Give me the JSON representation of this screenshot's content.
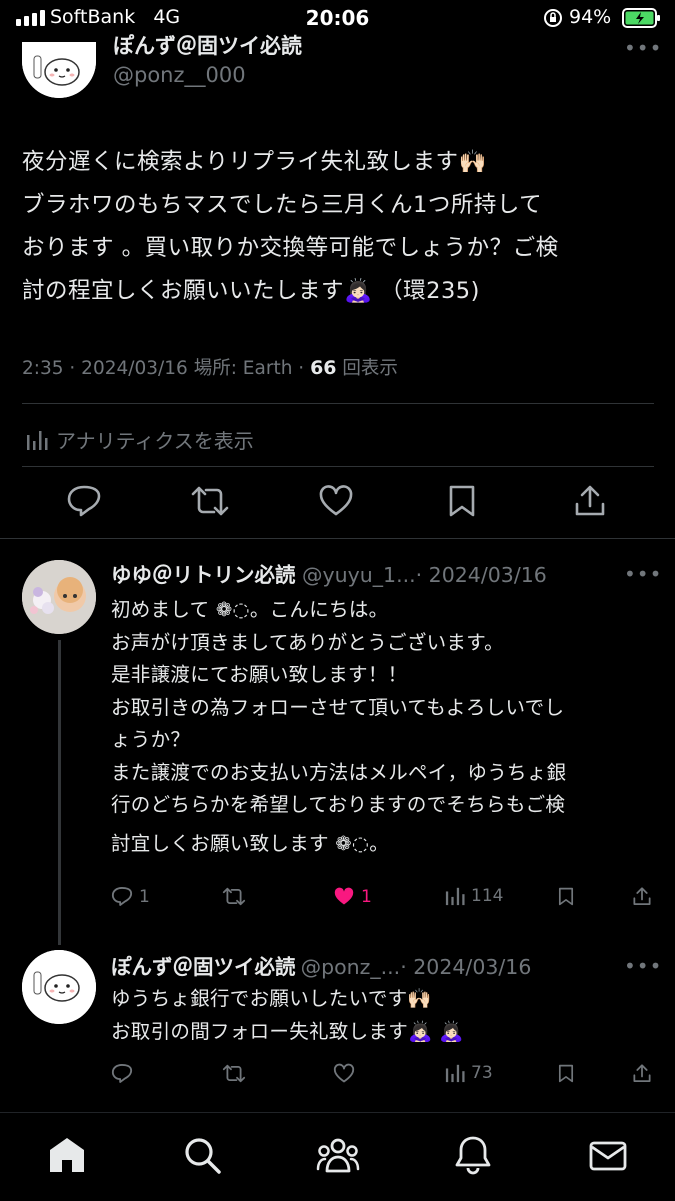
{
  "status_bar": {
    "carrier": "SoftBank",
    "network": "4G",
    "time": "20:06",
    "battery": "94%"
  },
  "main_tweet": {
    "author_name": "ぽんず＠固ツイ必読",
    "author_handle": "@ponz__000",
    "text_lines": [
      "夜分遅くに検索よりリプライ失礼致します🙌🏻",
      "ブラホワのもちマスでしたら三月くん1つ所持して",
      "おります 。買い取りか交換等可能でしょうか？ご検",
      "討の程宜しくお願いいたします🙇🏻‍♀️ （環235)"
    ],
    "meta_prefix": "2:35 · 2024/03/16 場所: Earth · ",
    "views_count": "66",
    "views_label": " 回表示",
    "analytics_label": "アナリティクスを表示"
  },
  "replies": [
    {
      "author_name": "ゆゆ＠リトリン必読",
      "author_handle": "@yuyu_1...",
      "date": "· 2024/03/16",
      "text_lines": [
        "初めまして ❁◌。こんにちは。",
        "お声がけ頂きましてありがとうございます。",
        "是非譲渡にてお願い致します！！",
        "お取引きの為フォローさせて頂いてもよろしいでし",
        "ょうか？",
        "また譲渡でのお支払い方法はメルペイ，ゆうちょ銀",
        "行のどちらかを希望しておりますのでそちらもご検",
        "討宜しくお願い致します ❁◌。"
      ],
      "replies": "1",
      "likes": "1",
      "views": "114"
    },
    {
      "author_name": "ぽんず＠固ツイ必読",
      "author_handle": "@ponz_...",
      "date": "· 2024/03/16",
      "text_lines": [
        "ゆうちょ銀行でお願いしたいです🙌🏻",
        "お取引の間フォロー失礼致します🙇🏻‍♀️ 🙇🏻‍♀️"
      ],
      "views": "73"
    }
  ],
  "more_glyph": "•••",
  "icons": [
    "home-icon",
    "search-icon",
    "communities-icon",
    "bell-icon",
    "mail-icon",
    "reply-icon",
    "retweet-icon",
    "like-icon",
    "bookmark-icon",
    "share-icon",
    "analytics-icon"
  ],
  "colors": {
    "background": "#000000",
    "text": "#e7e9ea",
    "muted": "#71767b",
    "like": "#f91880",
    "divider": "#2f3336"
  }
}
